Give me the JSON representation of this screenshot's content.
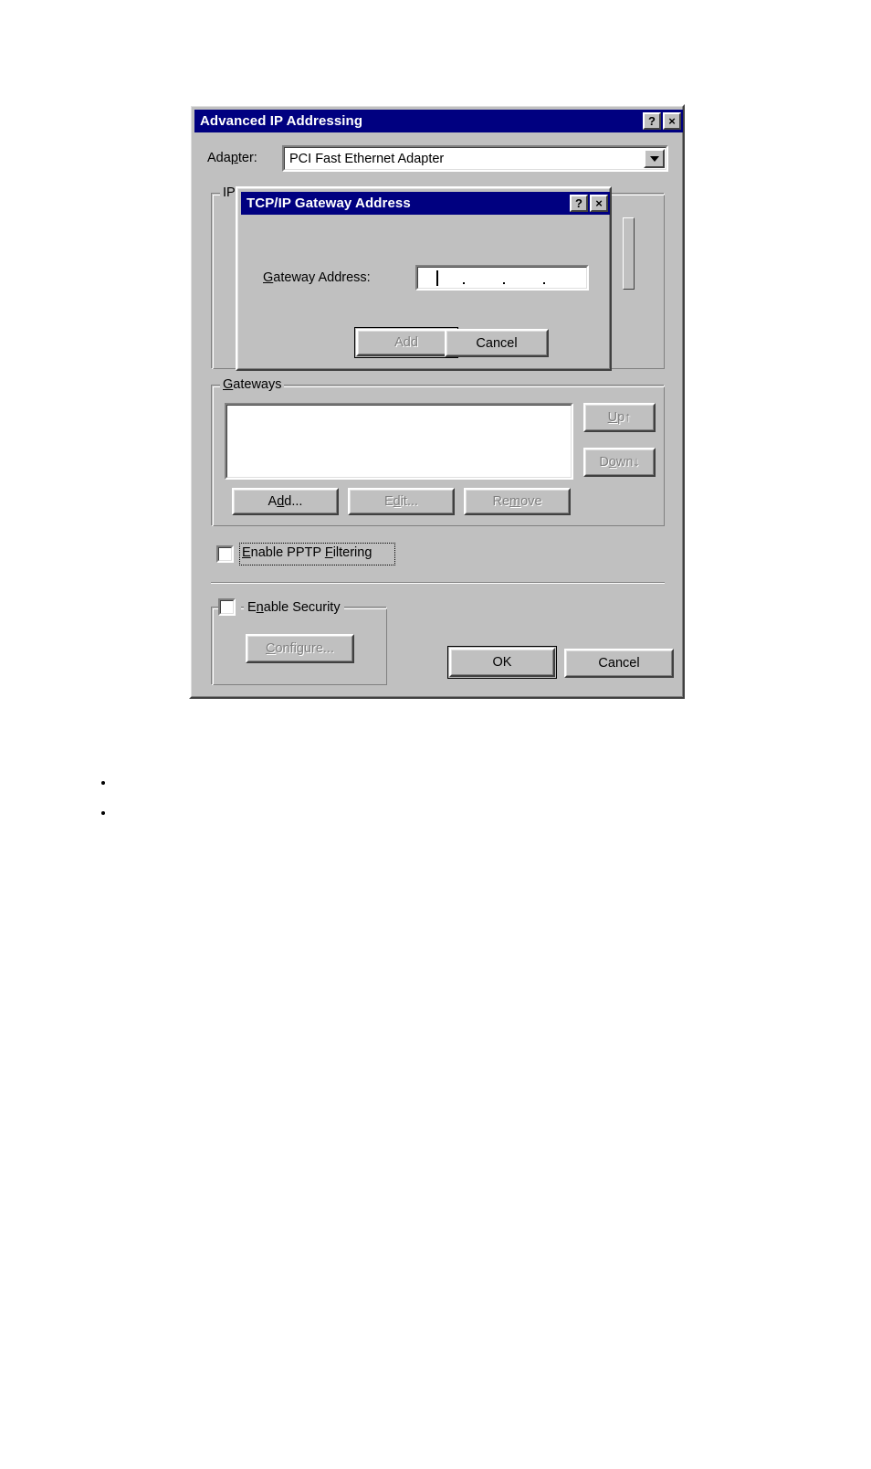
{
  "page": {
    "background": "#ffffff",
    "bullets": [
      "",
      ""
    ]
  },
  "colors": {
    "titlebar_active": "#000080",
    "dialog_face": "#c0c0c0",
    "field_background": "#ffffff",
    "disabled_text": "#808080",
    "text": "#000000"
  },
  "main_dialog": {
    "title": "Advanced IP Addressing",
    "titlebar_buttons": [
      {
        "name": "help",
        "glyph": "?"
      },
      {
        "name": "close",
        "glyph": "×"
      }
    ],
    "adapter": {
      "label": "Adapter:",
      "label_accelerator": "p",
      "value": "PCI Fast Ethernet Adapter",
      "arrow_icon": "chevron-down-icon"
    },
    "ip_group": {
      "title": "IP"
    },
    "gateways_group": {
      "title": "Gateways",
      "title_accelerator": "G",
      "list_items": [],
      "up_button": {
        "label": "Up↑",
        "enabled": false
      },
      "down_button": {
        "label": "Down↓",
        "enabled": false
      },
      "add_button": {
        "label": "Add...",
        "enabled": true
      },
      "edit_button": {
        "label": "Edit...",
        "enabled": false
      },
      "remove_button": {
        "label": "Remove",
        "enabled": false
      }
    },
    "pptp": {
      "label": "Enable PPTP Filtering",
      "checked": false,
      "focused": true
    },
    "security_group": {
      "label": "Enable Security",
      "checked": false,
      "configure_button": {
        "label": "Configure...",
        "enabled": false
      }
    },
    "ok_button": {
      "label": "OK",
      "default": true
    },
    "cancel_button": {
      "label": "Cancel",
      "default": false
    }
  },
  "child_dialog": {
    "title": "TCP/IP Gateway Address",
    "titlebar_buttons": [
      {
        "name": "help",
        "glyph": "?"
      },
      {
        "name": "close",
        "glyph": "×"
      }
    ],
    "gateway_address": {
      "label": "Gateway Address:",
      "label_accelerator": "G",
      "value": "",
      "placeholder": "   .   .   .   "
    },
    "add_button": {
      "label": "Add",
      "enabled": false,
      "default": true
    },
    "cancel_button": {
      "label": "Cancel",
      "enabled": true,
      "default": false
    }
  }
}
